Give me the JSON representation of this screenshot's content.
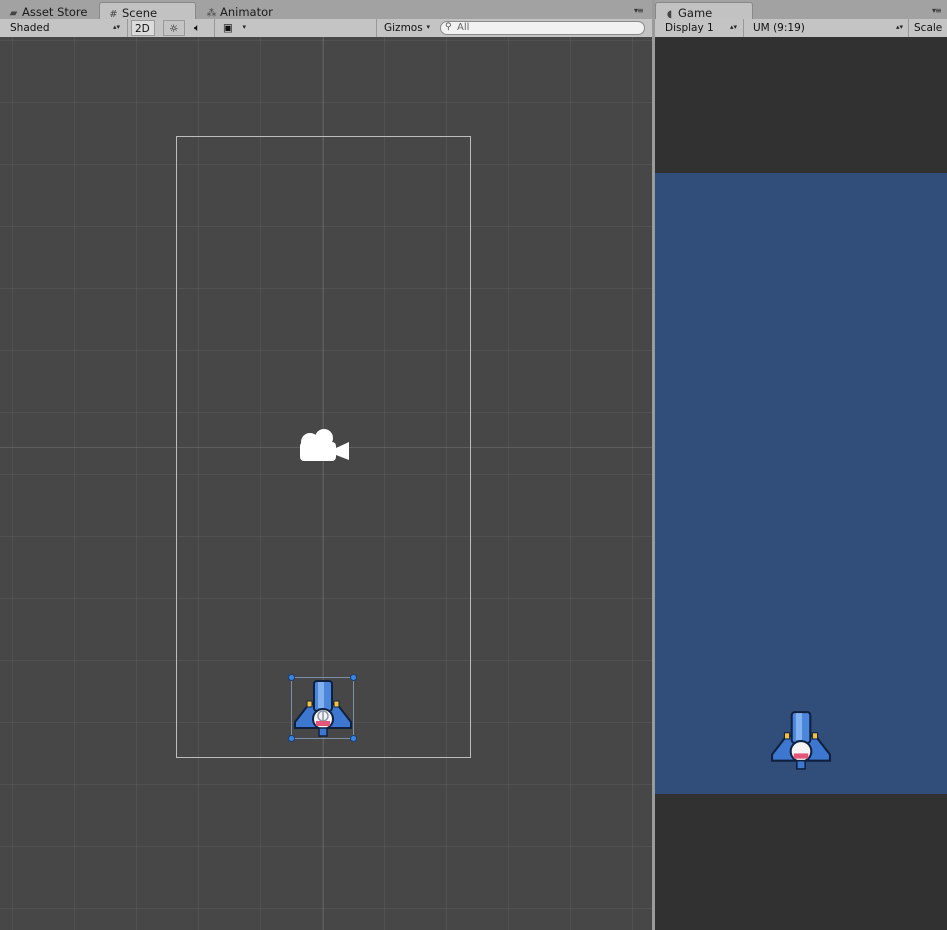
{
  "scene_panel": {
    "tabs": [
      {
        "label": "Asset Store",
        "icon": "shopping-bag-icon",
        "active": false
      },
      {
        "label": "Scene",
        "icon": "grid-hash-icon",
        "active": true
      },
      {
        "label": "Animator",
        "icon": "animator-nodes-icon",
        "active": false
      }
    ],
    "toolbar": {
      "draw_mode": "Shaded",
      "toggle_2d": "2D",
      "lighting_icon": "sun-icon",
      "audio_icon": "speaker-icon",
      "effects_icon": "image-icon",
      "gizmos": "Gizmos",
      "search_placeholder": "All"
    }
  },
  "game_panel": {
    "tabs": [
      {
        "label": "Game",
        "icon": "pacman-icon",
        "active": true
      }
    ],
    "toolbar": {
      "display": "Display 1",
      "aspect": "UM (9:19)",
      "scale": "Scale"
    }
  },
  "scene": {
    "objects": [
      {
        "name": "Main Camera",
        "icon": "camera-icon"
      },
      {
        "name": "Player",
        "icon": "spaceship-sprite",
        "selected": true
      }
    ]
  },
  "colors": {
    "scene_background": "#474747",
    "game_background": "#314D79",
    "letterbox": "#313131",
    "selection_handle": "#3A86E0"
  }
}
